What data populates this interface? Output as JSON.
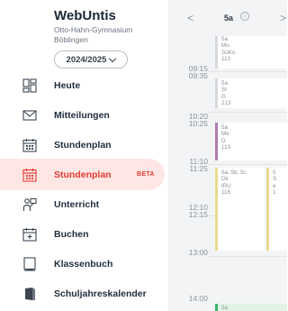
{
  "brand": {
    "title": "WebUntis",
    "school_line1": "Otto-Hahn-Gymnasium",
    "school_line2": "Böblingen"
  },
  "school_year": {
    "value": "2024/2025"
  },
  "nav": {
    "items": [
      {
        "label": "Heute",
        "icon": "dashboard-icon"
      },
      {
        "label": "Mitteilungen",
        "icon": "envelope-icon"
      },
      {
        "label": "Stundenplan",
        "icon": "calendar-icon"
      },
      {
        "label": "Stundenplan",
        "icon": "calendar-icon",
        "badge": "BETA",
        "active": true
      },
      {
        "label": "Unterricht",
        "icon": "lesson-icon"
      },
      {
        "label": "Buchen",
        "icon": "calendar-plus-icon"
      },
      {
        "label": "Klassenbuch",
        "icon": "book-icon"
      },
      {
        "label": "Schuljahreskalender",
        "icon": "year-calendar-icon"
      }
    ]
  },
  "timetable": {
    "class": "5a",
    "info_icon": "ⓘ",
    "prev": "<",
    "next": ">",
    "times": [
      {
        "start": "09:15",
        "end": "09:35"
      },
      {
        "start": "10:20",
        "end": "10:25"
      },
      {
        "start": "11:10",
        "end": "11:25"
      },
      {
        "start": "12:10",
        "end": "12:15"
      },
      {
        "start": "13:00",
        "end": ""
      },
      {
        "start": "14:00",
        "end": ""
      }
    ],
    "lessons": [
      {
        "lines": [
          "5a",
          "Mu",
          "SoKo",
          "113"
        ]
      },
      {
        "lines": [
          "5a",
          "Sr",
          "G",
          "213"
        ]
      },
      {
        "lines": [
          "5a",
          "Me",
          "D",
          "113"
        ]
      },
      {
        "lines": [
          "5a, 5b, 5c",
          "Dk",
          "IRU",
          "116"
        ]
      },
      {
        "lines": [
          "5",
          "S",
          "e",
          "1"
        ]
      },
      {
        "lines": [
          "5a"
        ]
      }
    ]
  },
  "colors": {
    "accent": "#e23b35",
    "active_bg": "#fde6e4",
    "lesson_purple": "#b07bb1",
    "lesson_yellow": "#e7dc8e",
    "lesson_green": "#3bb36a"
  }
}
